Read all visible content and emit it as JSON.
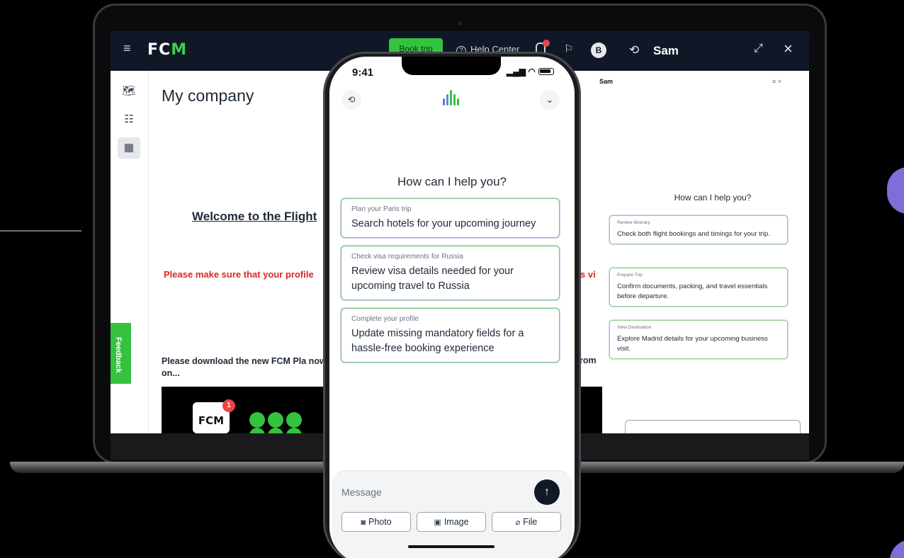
{
  "desktop": {
    "header": {
      "logo": "FCM",
      "book_trip": "Book trip",
      "help_center": "Help Center",
      "avatar_initial": "B"
    },
    "page_title": "My company",
    "welcome": "Welcome to the Flight",
    "warning": "Please make sure that your profile",
    "warning_tail": "s vi",
    "download": "Please download the new FCM Pla now on...",
    "download_tail": "rom",
    "feedback": "Feedback",
    "promo_logo": "FCM",
    "promo_badge": "1"
  },
  "sam_panel": {
    "title": "Sam",
    "mini_title": "Sam",
    "mini_icons": "≡  ×",
    "greeting": "How can I help you?",
    "cards": [
      {
        "kicker": "Review Itinerary",
        "text": "Check both flight bookings and timings for your trip."
      },
      {
        "kicker": "Prepare Trip",
        "text": "Confirm documents, packing, and travel essentials before departure."
      },
      {
        "kicker": "View Destination",
        "text": "Explore Madrid details for your upcoming business visit."
      }
    ]
  },
  "phone": {
    "time": "9:41",
    "greeting": "How can I help you?",
    "cards": [
      {
        "kicker": "Plan your Paris trip",
        "text": "Search hotels for your upcoming journey"
      },
      {
        "kicker": "Check visa requirements for Russia",
        "text": "Review visa details needed for your upcoming travel to Russia"
      },
      {
        "kicker": "Complete your profile",
        "text": "Update missing mandatory fields for a hassle-free booking experience"
      }
    ],
    "composer": {
      "placeholder": "Message",
      "photo": "Photo",
      "image": "Image",
      "file": "File"
    }
  },
  "icons": {
    "history": "history-icon",
    "sam_logo": "audio-bars-icon",
    "collapse": "chevron-down-icon",
    "send": "arrow-up-icon"
  },
  "colors": {
    "brand_green": "#35c23f",
    "header_dark": "#101828",
    "warning_red": "#dc2626",
    "accent_purple": "#7c6fd8"
  }
}
